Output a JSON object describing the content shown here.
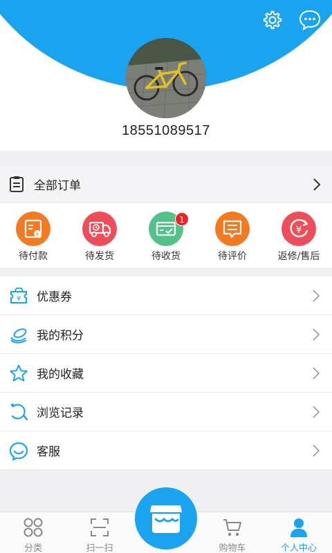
{
  "header": {
    "phone": "18551089517",
    "accent_color": "#1aa3ee",
    "icons": [
      "gear-icon",
      "chat-bubble-icon"
    ]
  },
  "orders": {
    "all_orders_label": "全部订单"
  },
  "order_status": [
    {
      "label": "待付款",
      "icon": "wallet-icon",
      "color": "#f37a22"
    },
    {
      "label": "待发货",
      "icon": "truck-icon",
      "color": "#ee4d5a"
    },
    {
      "label": "待收货",
      "icon": "received-icon",
      "color": "#52c28a",
      "badge": "1"
    },
    {
      "label": "待评价",
      "icon": "comment-icon",
      "color": "#f37a22"
    },
    {
      "label": "返修/售后",
      "icon": "refund-icon",
      "color": "#ee4d5a"
    }
  ],
  "menu": [
    {
      "label": "优惠券",
      "icon": "coupon-icon"
    },
    {
      "label": "我的积分",
      "icon": "points-icon"
    },
    {
      "label": "我的收藏",
      "icon": "star-icon"
    },
    {
      "label": "浏览记录",
      "icon": "history-icon"
    },
    {
      "label": "客服",
      "icon": "customer-service-icon"
    }
  ],
  "tabbar": [
    {
      "label": "分类",
      "icon": "category-icon"
    },
    {
      "label": "扫一扫",
      "icon": "scan-icon"
    },
    {
      "label": "",
      "icon": "store-icon"
    },
    {
      "label": "购物车",
      "icon": "cart-icon"
    },
    {
      "label": "个人中心",
      "icon": "person-icon",
      "active": true
    }
  ]
}
